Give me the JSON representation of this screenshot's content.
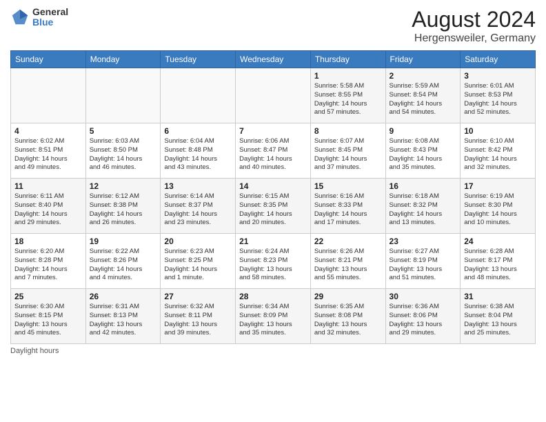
{
  "header": {
    "logo_line1": "General",
    "logo_line2": "Blue",
    "title": "August 2024",
    "subtitle": "Hergensweiler, Germany"
  },
  "calendar": {
    "days_of_week": [
      "Sunday",
      "Monday",
      "Tuesday",
      "Wednesday",
      "Thursday",
      "Friday",
      "Saturday"
    ],
    "weeks": [
      [
        {
          "day": "",
          "info": ""
        },
        {
          "day": "",
          "info": ""
        },
        {
          "day": "",
          "info": ""
        },
        {
          "day": "",
          "info": ""
        },
        {
          "day": "1",
          "info": "Sunrise: 5:58 AM\nSunset: 8:55 PM\nDaylight: 14 hours\nand 57 minutes."
        },
        {
          "day": "2",
          "info": "Sunrise: 5:59 AM\nSunset: 8:54 PM\nDaylight: 14 hours\nand 54 minutes."
        },
        {
          "day": "3",
          "info": "Sunrise: 6:01 AM\nSunset: 8:53 PM\nDaylight: 14 hours\nand 52 minutes."
        }
      ],
      [
        {
          "day": "4",
          "info": "Sunrise: 6:02 AM\nSunset: 8:51 PM\nDaylight: 14 hours\nand 49 minutes."
        },
        {
          "day": "5",
          "info": "Sunrise: 6:03 AM\nSunset: 8:50 PM\nDaylight: 14 hours\nand 46 minutes."
        },
        {
          "day": "6",
          "info": "Sunrise: 6:04 AM\nSunset: 8:48 PM\nDaylight: 14 hours\nand 43 minutes."
        },
        {
          "day": "7",
          "info": "Sunrise: 6:06 AM\nSunset: 8:47 PM\nDaylight: 14 hours\nand 40 minutes."
        },
        {
          "day": "8",
          "info": "Sunrise: 6:07 AM\nSunset: 8:45 PM\nDaylight: 14 hours\nand 37 minutes."
        },
        {
          "day": "9",
          "info": "Sunrise: 6:08 AM\nSunset: 8:43 PM\nDaylight: 14 hours\nand 35 minutes."
        },
        {
          "day": "10",
          "info": "Sunrise: 6:10 AM\nSunset: 8:42 PM\nDaylight: 14 hours\nand 32 minutes."
        }
      ],
      [
        {
          "day": "11",
          "info": "Sunrise: 6:11 AM\nSunset: 8:40 PM\nDaylight: 14 hours\nand 29 minutes."
        },
        {
          "day": "12",
          "info": "Sunrise: 6:12 AM\nSunset: 8:38 PM\nDaylight: 14 hours\nand 26 minutes."
        },
        {
          "day": "13",
          "info": "Sunrise: 6:14 AM\nSunset: 8:37 PM\nDaylight: 14 hours\nand 23 minutes."
        },
        {
          "day": "14",
          "info": "Sunrise: 6:15 AM\nSunset: 8:35 PM\nDaylight: 14 hours\nand 20 minutes."
        },
        {
          "day": "15",
          "info": "Sunrise: 6:16 AM\nSunset: 8:33 PM\nDaylight: 14 hours\nand 17 minutes."
        },
        {
          "day": "16",
          "info": "Sunrise: 6:18 AM\nSunset: 8:32 PM\nDaylight: 14 hours\nand 13 minutes."
        },
        {
          "day": "17",
          "info": "Sunrise: 6:19 AM\nSunset: 8:30 PM\nDaylight: 14 hours\nand 10 minutes."
        }
      ],
      [
        {
          "day": "18",
          "info": "Sunrise: 6:20 AM\nSunset: 8:28 PM\nDaylight: 14 hours\nand 7 minutes."
        },
        {
          "day": "19",
          "info": "Sunrise: 6:22 AM\nSunset: 8:26 PM\nDaylight: 14 hours\nand 4 minutes."
        },
        {
          "day": "20",
          "info": "Sunrise: 6:23 AM\nSunset: 8:25 PM\nDaylight: 14 hours\nand 1 minute."
        },
        {
          "day": "21",
          "info": "Sunrise: 6:24 AM\nSunset: 8:23 PM\nDaylight: 13 hours\nand 58 minutes."
        },
        {
          "day": "22",
          "info": "Sunrise: 6:26 AM\nSunset: 8:21 PM\nDaylight: 13 hours\nand 55 minutes."
        },
        {
          "day": "23",
          "info": "Sunrise: 6:27 AM\nSunset: 8:19 PM\nDaylight: 13 hours\nand 51 minutes."
        },
        {
          "day": "24",
          "info": "Sunrise: 6:28 AM\nSunset: 8:17 PM\nDaylight: 13 hours\nand 48 minutes."
        }
      ],
      [
        {
          "day": "25",
          "info": "Sunrise: 6:30 AM\nSunset: 8:15 PM\nDaylight: 13 hours\nand 45 minutes."
        },
        {
          "day": "26",
          "info": "Sunrise: 6:31 AM\nSunset: 8:13 PM\nDaylight: 13 hours\nand 42 minutes."
        },
        {
          "day": "27",
          "info": "Sunrise: 6:32 AM\nSunset: 8:11 PM\nDaylight: 13 hours\nand 39 minutes."
        },
        {
          "day": "28",
          "info": "Sunrise: 6:34 AM\nSunset: 8:09 PM\nDaylight: 13 hours\nand 35 minutes."
        },
        {
          "day": "29",
          "info": "Sunrise: 6:35 AM\nSunset: 8:08 PM\nDaylight: 13 hours\nand 32 minutes."
        },
        {
          "day": "30",
          "info": "Sunrise: 6:36 AM\nSunset: 8:06 PM\nDaylight: 13 hours\nand 29 minutes."
        },
        {
          "day": "31",
          "info": "Sunrise: 6:38 AM\nSunset: 8:04 PM\nDaylight: 13 hours\nand 25 minutes."
        }
      ]
    ]
  },
  "footer": {
    "note": "Daylight hours"
  }
}
